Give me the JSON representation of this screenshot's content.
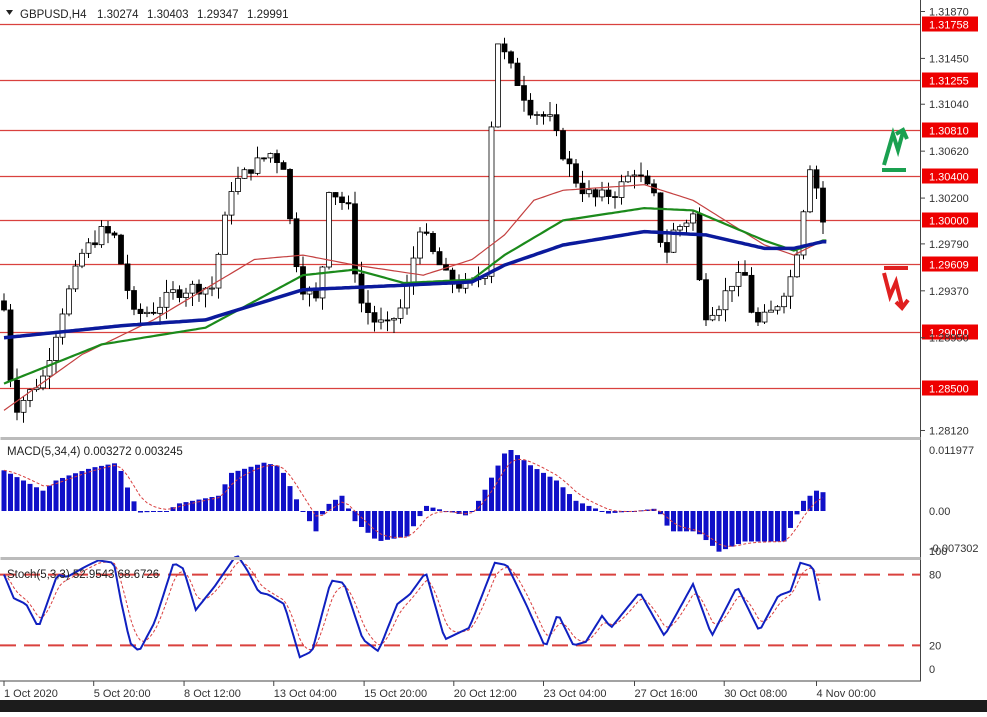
{
  "header": {
    "symbol": "GBPUSD,H4",
    "open": "1.30274",
    "high": "1.30403",
    "low": "1.29347",
    "close": "1.29991"
  },
  "colors": {
    "level_line": "#d9413e",
    "level_label_bg": "#ee0000",
    "candle": "#000000",
    "ma_slow": "#0b1a9c",
    "ma_mid": "#1b8a1b",
    "ma_fast": "#c44040",
    "macd_hist": "#1010c8",
    "signal": "#d94040",
    "stoch_main": "#1020c0",
    "up_arrow": "#1aa050",
    "down_arrow": "#e02020"
  },
  "icons": {
    "up": "green-zigzag-up-arrow-icon",
    "down": "red-zigzag-down-arrow-icon"
  },
  "chart_data": [
    {
      "type": "candlestick",
      "title": "GBPUSD,H4",
      "ylim": [
        1.2805,
        1.3195
      ],
      "price_ticks": [
        "1.31870",
        "1.31450",
        "1.31040",
        "1.30620",
        "1.30200",
        "1.29790",
        "1.29370",
        "1.28950",
        "1.28120"
      ],
      "price_tick_values": [
        1.3187,
        1.3145,
        1.3104,
        1.3062,
        1.302,
        1.2979,
        1.2937,
        1.2895,
        1.2812
      ],
      "levels": [
        "1.31758",
        "1.31255",
        "1.30810",
        "1.30400",
        "1.30000",
        "1.29609",
        "1.29000",
        "1.28500"
      ],
      "bars": 127,
      "close_anchors": [
        [
          0,
          1.292
        ],
        [
          1.5,
          1.283
        ],
        [
          6,
          1.286
        ],
        [
          9,
          1.292
        ],
        [
          12,
          1.297
        ],
        [
          15,
          1.299
        ],
        [
          17,
          1.2985
        ],
        [
          18.5,
          1.295
        ],
        [
          20,
          1.2915
        ],
        [
          23,
          1.292
        ],
        [
          26,
          1.2935
        ],
        [
          29,
          1.294
        ],
        [
          32,
          1.294
        ],
        [
          35,
          1.303
        ],
        [
          38.5,
          1.305
        ],
        [
          41,
          1.306
        ],
        [
          43,
          1.305
        ],
        [
          44.5,
          1.2975
        ],
        [
          46,
          1.294
        ],
        [
          48.5,
          1.2925
        ],
        [
          50,
          1.303
        ],
        [
          53,
          1.301
        ],
        [
          54.5,
          1.293
        ],
        [
          57,
          1.291
        ],
        [
          59,
          1.2905
        ],
        [
          61.5,
          1.2925
        ],
        [
          64,
          1.2995
        ],
        [
          66,
          1.297
        ],
        [
          68.5,
          1.2945
        ],
        [
          71.5,
          1.294
        ],
        [
          74,
          1.2955
        ],
        [
          74.5,
          1.305
        ],
        [
          76,
          1.316
        ],
        [
          78.5,
          1.313
        ],
        [
          81,
          1.31
        ],
        [
          84,
          1.309
        ],
        [
          86,
          1.306
        ],
        [
          88.5,
          1.303
        ],
        [
          91,
          1.302
        ],
        [
          94,
          1.3025
        ],
        [
          97,
          1.3045
        ],
        [
          100,
          1.302
        ],
        [
          101.5,
          1.2965
        ],
        [
          103,
          1.299
        ],
        [
          106,
          1.3005
        ],
        [
          107.5,
          1.2915
        ],
        [
          110,
          1.2925
        ],
        [
          112,
          1.2945
        ],
        [
          114,
          1.295
        ],
        [
          115.5,
          1.2905
        ],
        [
          118.5,
          1.292
        ],
        [
          121.5,
          1.2955
        ],
        [
          124,
          1.305
        ],
        [
          125.5,
          1.302
        ],
        [
          126,
          1.2999
        ]
      ],
      "moving_averages": [
        {
          "name": "ma_slow",
          "anchors": [
            [
              0,
              1.2895
            ],
            [
              18.5,
              1.2906
            ],
            [
              31,
              1.2911
            ],
            [
              46,
              1.2938
            ],
            [
              61.5,
              1.2942
            ],
            [
              72,
              1.2945
            ],
            [
              77,
              1.296
            ],
            [
              86,
              1.2978
            ],
            [
              98.5,
              1.299
            ],
            [
              108,
              1.2987
            ],
            [
              117,
              1.2975
            ],
            [
              121.5,
              1.2975
            ],
            [
              126,
              1.2981
            ]
          ]
        },
        {
          "name": "ma_mid",
          "anchors": [
            [
              0,
              1.2854
            ],
            [
              15,
              1.2889
            ],
            [
              31,
              1.2904
            ],
            [
              46,
              1.2951
            ],
            [
              54,
              1.2956
            ],
            [
              61.5,
              1.2944
            ],
            [
              72,
              1.2947
            ],
            [
              77,
              1.2969
            ],
            [
              86,
              1.3
            ],
            [
              98.5,
              1.3011
            ],
            [
              106,
              1.3009
            ],
            [
              117,
              1.2982
            ],
            [
              121.5,
              1.2973
            ],
            [
              126,
              1.2982
            ]
          ]
        },
        {
          "name": "ma_fast",
          "anchors": [
            [
              0,
              1.283
            ],
            [
              12,
              1.288
            ],
            [
              23,
              1.2911
            ],
            [
              38.5,
              1.2965
            ],
            [
              46,
              1.2969
            ],
            [
              54,
              1.296
            ],
            [
              64.5,
              1.2951
            ],
            [
              72,
              1.2965
            ],
            [
              77,
              1.2987
            ],
            [
              81.5,
              1.3018
            ],
            [
              86,
              1.3027
            ],
            [
              98.5,
              1.3032
            ],
            [
              106,
              1.3018
            ],
            [
              117,
              1.2978
            ],
            [
              121.5,
              1.2969
            ],
            [
              126,
              1.2982
            ]
          ]
        }
      ],
      "x_labels": [
        "1 Oct 2020",
        "5 Oct 20:00",
        "8 Oct 12:00",
        "13 Oct 04:00",
        "15 Oct 20:00",
        "20 Oct 12:00",
        "23 Oct 04:00",
        "27 Oct 16:00",
        "30 Oct 08:00",
        "4 Nov 00:00"
      ],
      "x_label_bars": [
        0,
        13.8,
        27.7,
        41.5,
        55.4,
        69.2,
        83,
        97,
        110.8,
        125
      ]
    },
    {
      "type": "bar",
      "title": "MACD(5,34,4) 0.003272 0.003245",
      "ylim": [
        -0.007302,
        0.011977
      ],
      "ticks": [
        "0.011977",
        "0.00",
        "-0.007302"
      ],
      "tick_values": [
        0.011977,
        0,
        -0.007302
      ],
      "hist_anchors": [
        [
          0,
          0.008
        ],
        [
          3,
          0.006
        ],
        [
          6,
          0.004
        ],
        [
          8,
          0.006
        ],
        [
          10,
          0.007
        ],
        [
          13.5,
          0.0085
        ],
        [
          17.5,
          0.0095
        ],
        [
          19.5,
          0.003
        ],
        [
          21,
          -0.0003
        ],
        [
          25,
          0
        ],
        [
          27,
          0.0015
        ],
        [
          33,
          0.003
        ],
        [
          35,
          0.0075
        ],
        [
          40,
          0.0095
        ],
        [
          42.5,
          0.0088
        ],
        [
          45.5,
          0.001
        ],
        [
          48,
          -0.004
        ],
        [
          49.5,
          0.001
        ],
        [
          52,
          0.003
        ],
        [
          54,
          -0.002
        ],
        [
          57.5,
          -0.006
        ],
        [
          62,
          -0.005
        ],
        [
          65,
          0.001
        ],
        [
          68,
          0
        ],
        [
          71.5,
          -0.001
        ],
        [
          73.5,
          0.003
        ],
        [
          77.5,
          0.0125
        ],
        [
          81,
          0.009
        ],
        [
          85,
          0.006
        ],
        [
          88,
          0.002
        ],
        [
          91,
          0.0005
        ],
        [
          93,
          -0.0005
        ],
        [
          97,
          0
        ],
        [
          100.5,
          0.0005
        ],
        [
          102.5,
          -0.004
        ],
        [
          106.5,
          -0.004
        ],
        [
          110,
          -0.008
        ],
        [
          114,
          -0.006
        ],
        [
          120,
          -0.006
        ],
        [
          123,
          0.002
        ],
        [
          125,
          0.004
        ],
        [
          126,
          0.0037
        ]
      ]
    },
    {
      "type": "line",
      "title": "Stoch(5,3,3) 52.9543 68.6726",
      "ylim": [
        0,
        100
      ],
      "ticks": [
        "100",
        "80",
        "20",
        "0"
      ],
      "tick_values": [
        100,
        80,
        20,
        0
      ],
      "levels": [
        80,
        20
      ],
      "main_anchors": [
        [
          0,
          80
        ],
        [
          1.5,
          60
        ],
        [
          3.4,
          55
        ],
        [
          5.3,
          35
        ],
        [
          8.2,
          80
        ],
        [
          9.7,
          78
        ],
        [
          12.6,
          87
        ],
        [
          14.5,
          92
        ],
        [
          16.9,
          90
        ],
        [
          17.9,
          60
        ],
        [
          19.4,
          22
        ],
        [
          20.8,
          15
        ],
        [
          23.2,
          40
        ],
        [
          26.1,
          90
        ],
        [
          27.6,
          85
        ],
        [
          29.5,
          50
        ],
        [
          32.4,
          70
        ],
        [
          35.8,
          97
        ],
        [
          37.3,
          85
        ],
        [
          39.2,
          65
        ],
        [
          40.7,
          63
        ],
        [
          43.1,
          55
        ],
        [
          45.5,
          10
        ],
        [
          47.4,
          15
        ],
        [
          50.3,
          75
        ],
        [
          52.3,
          73
        ],
        [
          55.2,
          25
        ],
        [
          57.6,
          15
        ],
        [
          60.5,
          55
        ],
        [
          62.4,
          63
        ],
        [
          64.9,
          82
        ],
        [
          67.8,
          25
        ],
        [
          71.6,
          35
        ],
        [
          75.5,
          90
        ],
        [
          77.4,
          88
        ],
        [
          80.3,
          55
        ],
        [
          83.3,
          18
        ],
        [
          85.2,
          47
        ],
        [
          87.6,
          20
        ],
        [
          89.5,
          23
        ],
        [
          92,
          45
        ],
        [
          93.4,
          35
        ],
        [
          97.8,
          65
        ],
        [
          101.6,
          28
        ],
        [
          106,
          72
        ],
        [
          108.9,
          28
        ],
        [
          112.8,
          70
        ],
        [
          116.2,
          32
        ],
        [
          119.1,
          62
        ],
        [
          121,
          66
        ],
        [
          122.5,
          90
        ],
        [
          124.4,
          87
        ],
        [
          125.8,
          50
        ]
      ]
    }
  ]
}
